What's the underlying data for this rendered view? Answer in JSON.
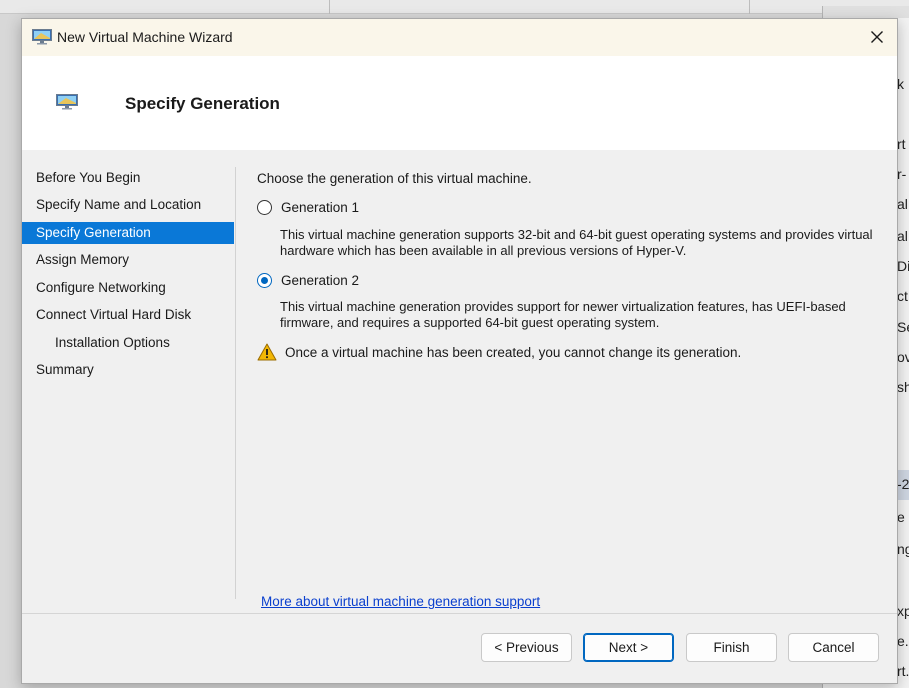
{
  "window": {
    "title": "New Virtual Machine Wizard",
    "close_glyph": "✕"
  },
  "header": {
    "title": "Specify Generation"
  },
  "nav": {
    "items": [
      {
        "label": "Before You Begin",
        "active": false
      },
      {
        "label": "Specify Name and Location",
        "active": false
      },
      {
        "label": "Specify Generation",
        "active": true
      },
      {
        "label": "Assign Memory",
        "active": false
      },
      {
        "label": "Configure Networking",
        "active": false
      },
      {
        "label": "Connect Virtual Hard Disk",
        "active": false
      },
      {
        "label": "Installation Options",
        "active": false
      },
      {
        "label": "Summary",
        "active": false
      }
    ]
  },
  "content": {
    "intro": "Choose the generation of this virtual machine.",
    "gen1": {
      "label": "Generation 1",
      "selected": false,
      "description": "This virtual machine generation supports 32-bit and 64-bit guest operating systems and provides virtual hardware which has been available in all previous versions of Hyper-V."
    },
    "gen2": {
      "label": "Generation 2",
      "selected": true,
      "description": "This virtual machine generation provides support for newer virtualization features, has UEFI-based firmware, and requires a supported 64-bit guest operating system."
    },
    "warning": "Once a virtual machine has been created, you cannot change its generation.",
    "more_link": "More about virtual machine generation support"
  },
  "buttons": {
    "previous": "< Previous",
    "next": "Next >",
    "finish": "Finish",
    "cancel": "Cancel"
  },
  "background": {
    "fragments": [
      "k",
      "rt",
      "r-",
      "al",
      "al",
      "Di",
      "ct",
      "Se",
      "ov",
      "sh",
      "-2",
      "e",
      "ng",
      "xp",
      "e.",
      "rt."
    ]
  },
  "icons": {
    "title": "monitor-icon",
    "header": "monitor-icon",
    "warning": "warning-icon",
    "close": "close-icon"
  },
  "colors": {
    "accent": "#0a78d7",
    "link": "#0a3fce",
    "radio": "#0067c0",
    "warning": "#f2b705"
  }
}
